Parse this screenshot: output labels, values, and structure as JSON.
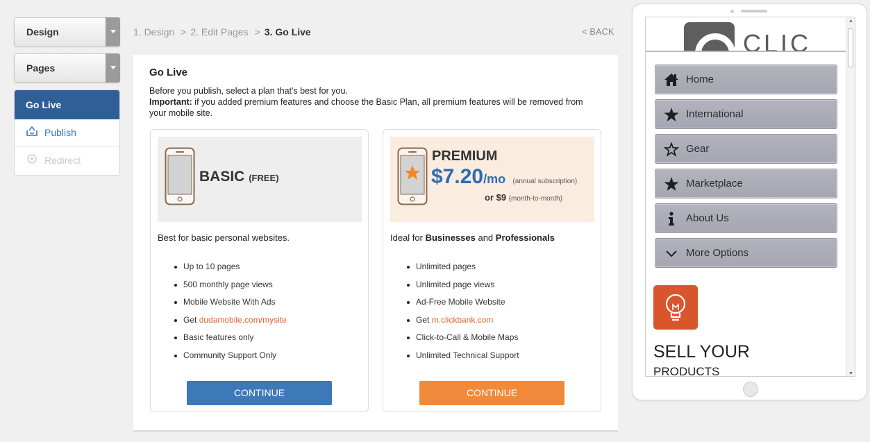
{
  "sidebar": {
    "design_label": "Design",
    "pages_label": "Pages",
    "active_label": "Go Live",
    "publish_label": "Publish",
    "redirect_label": "Redirect"
  },
  "breadcrumb": {
    "step1": "1. Design",
    "step2": "2. Edit Pages",
    "step3": "3. Go Live",
    "separator": ">",
    "back_label": "< BACK"
  },
  "main": {
    "title": "Go Live",
    "intro_line1": "Before you publish, select a plan that's best for you.",
    "important_label": "Important:",
    "important_text": " if you added premium features and choose the Basic Plan, all premium features will be removed from your mobile site."
  },
  "plans": {
    "basic": {
      "name": "BASIC",
      "name_suffix": "(FREE)",
      "description": "Best for basic personal websites.",
      "features": [
        "Up to 10 pages",
        "500 monthly page views",
        "Mobile Website With Ads"
      ],
      "get_prefix": "Get ",
      "get_link": "dudamobile.com/mysite",
      "features_after": [
        "Basic features only",
        "Community Support Only"
      ],
      "button_label": "CONTINUE"
    },
    "premium": {
      "name": "PREMIUM",
      "price": "$7.20",
      "price_unit": "/mo",
      "price_note": "(annual subscription)",
      "alt_price": "or $9",
      "alt_note": "(month-to-month)",
      "desc_prefix": "Ideal for ",
      "desc_bold1": "Businesses",
      "desc_mid": " and ",
      "desc_bold2": "Professionals",
      "features": [
        "Unlimited pages",
        "Unlimited page views",
        "Ad-Free Mobile Website"
      ],
      "get_prefix": "Get ",
      "get_link": "m.clickbank.com",
      "features_after": [
        "Click-to-Call & Mobile Maps",
        "Unlimited Technical Support"
      ],
      "button_label": "CONTINUE"
    }
  },
  "preview": {
    "logo_text": "CLIC",
    "nav": [
      {
        "label": "Home",
        "icon": "home-icon"
      },
      {
        "label": "International",
        "icon": "star-filled-icon"
      },
      {
        "label": "Gear",
        "icon": "star-outline-icon"
      },
      {
        "label": "Marketplace",
        "icon": "star-filled-icon"
      },
      {
        "label": "About Us",
        "icon": "info-icon"
      },
      {
        "label": "More Options",
        "icon": "chevron-down-icon"
      }
    ],
    "promo_title": "SELL YOUR",
    "promo_sub": "PRODUCTS"
  },
  "colors": {
    "active_nav": "#2f5f97",
    "basic_button": "#3d79b8",
    "premium_button": "#f0893a",
    "premium_price": "#2f6cb0",
    "link": "#e0662a",
    "promo_tile": "#d9552c"
  }
}
